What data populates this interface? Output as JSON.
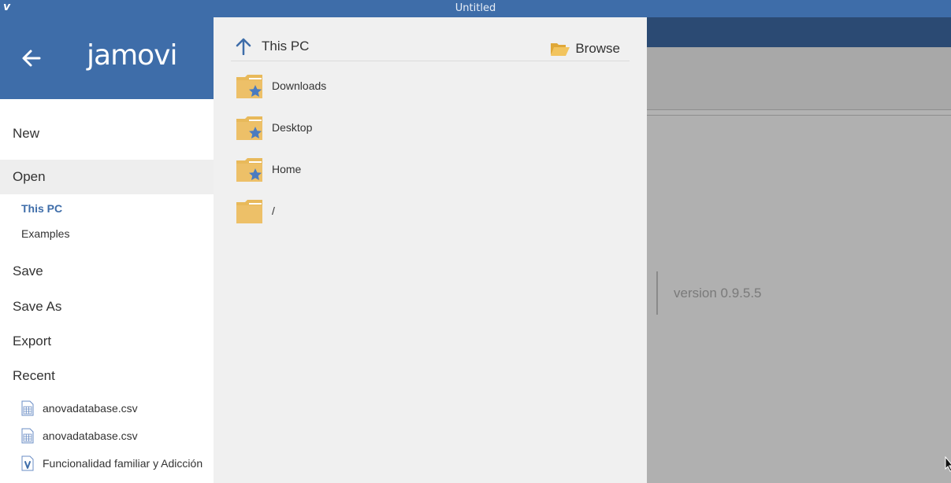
{
  "window": {
    "title": "Untitled",
    "app_icon": "jamovi-icon"
  },
  "sidebar": {
    "logo": "jamovi",
    "back_icon": "back-arrow-icon",
    "menu": {
      "new": "New",
      "open": "Open",
      "open_sub": [
        "This PC",
        "Examples"
      ],
      "save": "Save",
      "save_as": "Save As",
      "export": "Export",
      "recent": "Recent"
    },
    "recent_files": [
      {
        "name": "anovadatabase.csv",
        "icon": "csv-file-icon"
      },
      {
        "name": "anovadatabase.csv",
        "icon": "csv-file-icon"
      },
      {
        "name": "Funcionalidad familiar y Adicción",
        "icon": "jamovi-file-icon"
      }
    ]
  },
  "panel": {
    "title": "This PC",
    "up_icon": "up-arrow-icon",
    "browse_label": "Browse",
    "folders": [
      {
        "name": "Downloads",
        "icon": "starred-folder-icon"
      },
      {
        "name": "Desktop",
        "icon": "starred-folder-icon"
      },
      {
        "name": "Home",
        "icon": "starred-folder-icon"
      },
      {
        "name": "/",
        "icon": "folder-icon"
      }
    ]
  },
  "background": {
    "version": "version 0.9.5.5"
  },
  "colors": {
    "brand": "#3e6da9",
    "folder": "#e8b95a",
    "star": "#4a7bc0"
  }
}
